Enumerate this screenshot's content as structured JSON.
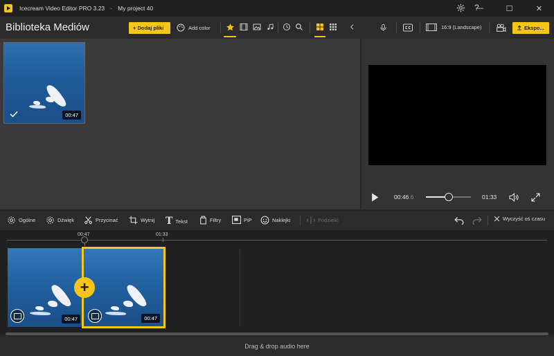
{
  "window": {
    "app_title": "Icecream Video Editor PRO 3.23",
    "separator": "-",
    "project_title": "My project 40",
    "help_label": "?",
    "minimize_label": "—",
    "maximize_label": "☐",
    "close_label": "✕"
  },
  "header": {
    "library_title": "Biblioteka Mediów",
    "add_files_label": "+ Dodaj pliki",
    "add_color_label": "Add color",
    "aspect_label": "16:9 (Landscape)",
    "export_label": "Ekspo..."
  },
  "library": {
    "items": [
      {
        "duration": "00:47",
        "selected": true
      }
    ]
  },
  "preview": {
    "current_time": "00:46",
    "current_frame": ".6",
    "total_time": "01:33",
    "progress": 0.5
  },
  "edit_tools": {
    "general": "Ogólne",
    "sound": "Dźwięk",
    "trim": "Przycinać",
    "crop": "Wytnij",
    "text": "Tekst",
    "filters": "Filtry",
    "pip": "PiP",
    "stickers": "Naklejki",
    "split": "Podzielić",
    "clear_timeline": "Wyczyść oś czasu",
    "text_glyph": "T"
  },
  "timeline": {
    "ticks": [
      {
        "label": "00:47"
      },
      {
        "label": "01:33"
      }
    ],
    "clips": [
      {
        "duration": "00:47",
        "selected": false
      },
      {
        "duration": "00:47",
        "selected": true
      }
    ],
    "add_label": "+"
  },
  "audio": {
    "drop_label": "Drag & drop audio here"
  },
  "colors": {
    "accent": "#f5c518",
    "background": "#262626",
    "panel": "#3a3a3a"
  }
}
